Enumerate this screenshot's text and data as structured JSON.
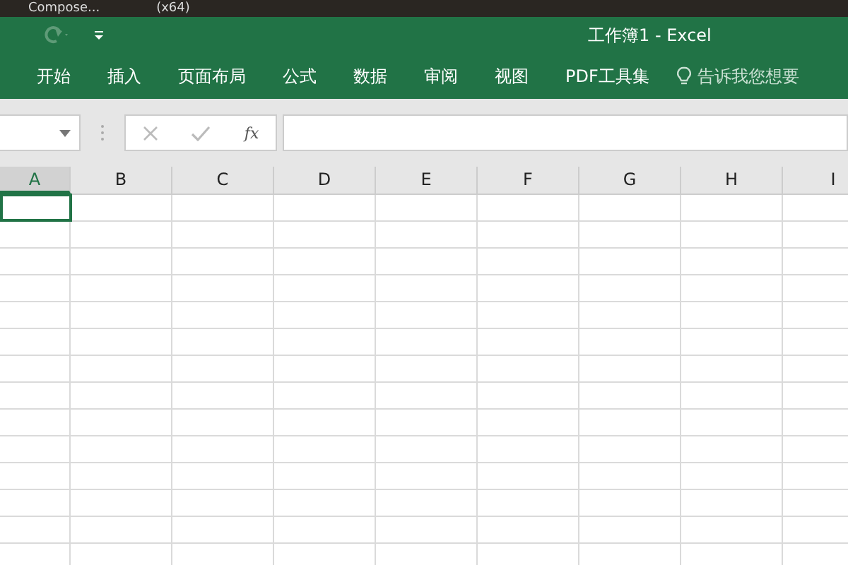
{
  "taskbar": {
    "items": [
      "Compose...",
      "(x64)"
    ]
  },
  "window": {
    "title": "工作簿1 - Excel"
  },
  "ribbon_tabs": [
    {
      "label": "开始",
      "selected": false
    },
    {
      "label": "插入",
      "selected": false
    },
    {
      "label": "页面布局",
      "selected": false
    },
    {
      "label": "公式",
      "selected": false
    },
    {
      "label": "数据",
      "selected": false
    },
    {
      "label": "审阅",
      "selected": false
    },
    {
      "label": "视图",
      "selected": false
    },
    {
      "label": "PDF工具集",
      "selected": false
    }
  ],
  "tell_me": {
    "placeholder": "告诉我您想要"
  },
  "formula_bar": {
    "fx": "fx"
  },
  "sheet": {
    "columns": [
      {
        "label": "A",
        "selected": true
      },
      {
        "label": "B",
        "selected": false
      },
      {
        "label": "C",
        "selected": false
      },
      {
        "label": "D",
        "selected": false
      },
      {
        "label": "E",
        "selected": false
      },
      {
        "label": "F",
        "selected": false
      },
      {
        "label": "G",
        "selected": false
      },
      {
        "label": "H",
        "selected": false
      },
      {
        "label": "I",
        "selected": false
      }
    ]
  }
}
